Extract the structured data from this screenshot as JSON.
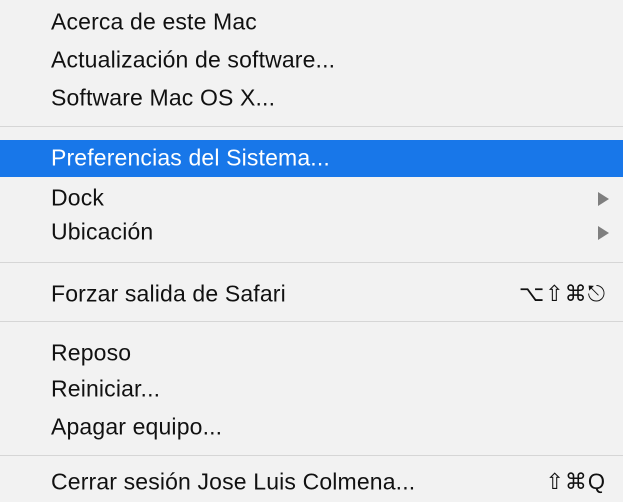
{
  "menu": {
    "items": [
      {
        "label": "Acerca de este Mac"
      },
      {
        "label": "Actualización de software..."
      },
      {
        "label": "Software Mac OS X..."
      },
      {
        "label": "Preferencias del Sistema...",
        "highlighted": true
      },
      {
        "label": "Dock",
        "submenu": true,
        "arrow_icon": "chevron-right-icon"
      },
      {
        "label": "Ubicación",
        "submenu": true,
        "arrow_icon": "chevron-right-icon"
      },
      {
        "label": "Forzar salida de Safari",
        "shortcut": "⌥⇧⌘⎋"
      },
      {
        "label": "Reposo"
      },
      {
        "label": "Reiniciar..."
      },
      {
        "label": "Apagar equipo..."
      },
      {
        "label": "Cerrar sesión Jose Luis Colmena...",
        "shortcut": "⇧⌘Q"
      }
    ]
  },
  "colors": {
    "background": "#f2f2f2",
    "highlight": "#1877e9",
    "highlight_text": "#ffffff",
    "text": "#111111",
    "separator": "#d6d6d6",
    "arrow": "#7f7f7f"
  }
}
